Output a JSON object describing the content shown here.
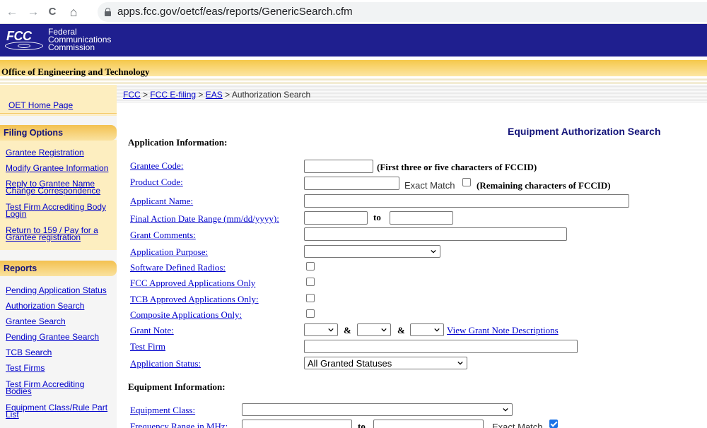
{
  "browser": {
    "url": "apps.fcc.gov/oetcf/eas/reports/GenericSearch.cfm",
    "back_glyph": "←",
    "forward_glyph": "→",
    "reload_glyph": "C",
    "home_glyph": "⌂"
  },
  "header": {
    "logo_text": "FCC",
    "org_name_line1": "Federal",
    "org_name_line2": "Communications",
    "org_name_line3": "Commission",
    "brand_color": "#1f1f8f"
  },
  "office": {
    "title": "Office of Engineering and Technology"
  },
  "sidebar": {
    "home_link": "OET Home Page",
    "filing_options": {
      "heading": "Filing Options",
      "items": [
        "Grantee Registration",
        "Modify Grantee Information",
        "Reply to Grantee Name",
        "Change Correspondence",
        "Test Firm Accrediting Body",
        "Login",
        "Return to 159 / Pay for a",
        "Grantee registration"
      ]
    },
    "reports": {
      "heading": "Reports",
      "items": [
        "Pending Application Status",
        "Authorization Search",
        "Grantee Search",
        "Pending Grantee Search",
        "TCB Search",
        "Test Firms",
        "Test Firm Accrediting",
        "Bodies",
        "Equipment Class/Rule Part",
        "List"
      ]
    }
  },
  "breadcrumb": {
    "items": [
      "FCC",
      "FCC E-filing",
      "EAS"
    ],
    "separator": ">",
    "current": "Authorization Search"
  },
  "main": {
    "page_title": "Equipment Authorization Search",
    "application_section": "Application Information:",
    "equipment_section": "Equipment Information:",
    "fields": {
      "grantee_code": {
        "label": "Grantee Code:",
        "hint": "(First three or five characters of FCCID)",
        "value": ""
      },
      "product_code": {
        "label": "Product Code:",
        "exact_match_label": "Exact Match",
        "exact_match": false,
        "hint": "(Remaining characters of FCCID)",
        "value": ""
      },
      "applicant_name": {
        "label": "Applicant Name:",
        "value": ""
      },
      "final_action_date": {
        "label": "Final Action Date Range (mm/dd/yyyy):",
        "to_label": "to",
        "from": "",
        "to": ""
      },
      "grant_comments": {
        "label": "Grant Comments:",
        "value": ""
      },
      "application_purpose": {
        "label": "Application Purpose:",
        "selected": ""
      },
      "software_defined_radios": {
        "label": "Software Defined Radios:",
        "checked": false
      },
      "fcc_approved_only": {
        "label": "FCC Approved Applications Only",
        "checked": false
      },
      "tcb_approved_only": {
        "label": "TCB Approved Applications Only:",
        "checked": false
      },
      "composite_only": {
        "label": "Composite Applications Only:",
        "checked": false
      },
      "grant_note": {
        "label": "Grant Note:",
        "amp": "&",
        "link": "View Grant Note Descriptions"
      },
      "test_firm": {
        "label": "Test Firm",
        "value": ""
      },
      "application_status": {
        "label": "Application Status:",
        "selected": "All Granted Statuses"
      },
      "equipment_class": {
        "label": "Equipment Class:",
        "selected": ""
      },
      "frequency_range": {
        "label": "Frequency Range in MHz:",
        "to_label": "to",
        "exact_match_label": "Exact Match",
        "exact_match": true
      }
    }
  }
}
